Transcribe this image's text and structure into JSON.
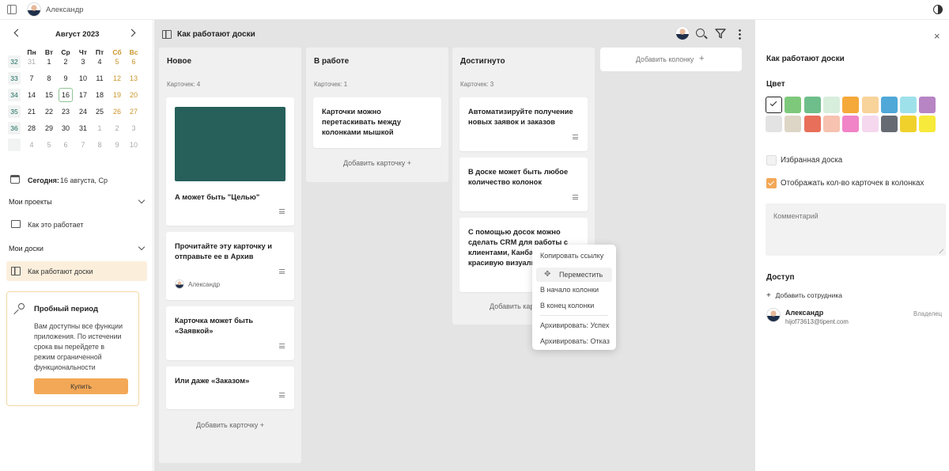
{
  "user": {
    "name": "Александр"
  },
  "calendar": {
    "month": "Август 2023",
    "weekdays": [
      "Пн",
      "Вт",
      "Ср",
      "Чт",
      "Пт",
      "Сб",
      "Вс"
    ],
    "weeks": [
      "32",
      "33",
      "34",
      "35",
      "36",
      ""
    ],
    "rows": [
      [
        "31",
        "1",
        "2",
        "3",
        "4",
        "5",
        "6"
      ],
      [
        "7",
        "8",
        "9",
        "10",
        "11",
        "12",
        "13"
      ],
      [
        "14",
        "15",
        "16",
        "17",
        "18",
        "19",
        "20"
      ],
      [
        "21",
        "22",
        "23",
        "24",
        "25",
        "26",
        "27"
      ],
      [
        "28",
        "29",
        "30",
        "31",
        "1",
        "2",
        "3"
      ],
      [
        "4",
        "5",
        "6",
        "7",
        "8",
        "9",
        "10"
      ]
    ],
    "today_label": "Сегодня:",
    "today_value": "16 августа, Ср"
  },
  "sidebar": {
    "projects_title": "Мои проекты",
    "project_item": "Как это работает",
    "boards_title": "Мои доски",
    "board_item": "Как работают доски"
  },
  "trial": {
    "title": "Пробный период",
    "text_lines": [
      "Вам доступны все функции",
      "приложения. По истечении",
      "срока вы перейдете в",
      "режим ограниченной",
      "функциональности"
    ],
    "button": "Купить"
  },
  "board": {
    "title": "Как работают доски",
    "add_column": "Добавить колонку",
    "add_card": "Добавить карточку",
    "columns": [
      {
        "title": "Новое",
        "count": "Карточек: 4",
        "cards": [
          {
            "lines": [
              "А может быть \"Целью\""
            ]
          },
          {
            "lines": [
              "Прочитайте эту карточку и",
              "отправьте ее в Архив"
            ],
            "assignee": "Александр"
          },
          {
            "lines": [
              "Карточка может быть",
              "«Заявкой»"
            ]
          },
          {
            "lines": [
              "Или даже «Заказом»"
            ]
          }
        ]
      },
      {
        "title": "В работе",
        "count": "Карточек: 1",
        "cards": [
          {
            "lines": [
              "Карточки можно",
              "перетаскивать между",
              "колонками мышкой"
            ]
          }
        ]
      },
      {
        "title": "Достигнуто",
        "count": "Карточек: 3",
        "cards": [
          {
            "lines": [
              "Автоматизируйте получение",
              "новых заявок и заказов"
            ]
          },
          {
            "lines": [
              "В доске может быть любое",
              "количество колонок"
            ]
          },
          {
            "lines": [
              "С помощью досок можно",
              "сделать CRM для работы с",
              "клиентами, Канба",
              "красивую визуали"
            ]
          }
        ]
      }
    ],
    "add_card_partial": "Добавить карто"
  },
  "context_menu": {
    "copy_link": "Копировать ссылку",
    "move": "Переместить",
    "to_start": "В начало колонки",
    "to_end": "В конец колонки",
    "archive_success": "Архивировать: Успех",
    "archive_fail": "Архивировать: Отказ"
  },
  "panel": {
    "title": "Как работают доски",
    "color_label": "Цвет",
    "colors_row1": [
      "#ffffff",
      "#7ec87b",
      "#6ebe8b",
      "#d8eedc",
      "#f5a93a",
      "#f8d39a",
      "#4fa8d8",
      "#9fe1ea",
      "#b784c4"
    ],
    "colors_row2": [
      "#e3e3e3",
      "#ddd5c6",
      "#e86f5a",
      "#f7c2b0",
      "#f183c7",
      "#f5d8ee",
      "#666b73",
      "#f0d12c",
      "#f7ea3a"
    ],
    "favorite_label": "Избранная доска",
    "show_count_label": "Отображать кол-во карточек в колонках",
    "comment_placeholder": "Комментарий",
    "access_title": "Доступ",
    "add_employee": "Добавить сотрудника",
    "member_name": "Александр",
    "member_email": "hijof73613@tipent.com",
    "member_role": "Владелец"
  },
  "accent_color": "#f3a857",
  "card_image_color": "#275f5a"
}
